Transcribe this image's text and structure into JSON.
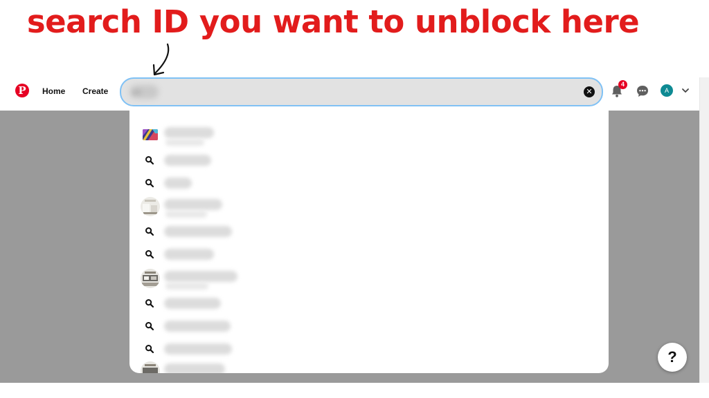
{
  "caption": {
    "text": "search ID you want to unblock here",
    "color": "#e21c1c"
  },
  "colors": {
    "brand": "#e60023",
    "focus_ring": "#7fc1f5",
    "search_bg": "#e2e2e2",
    "backdrop": "#9a9a9a",
    "avatar_bg": "#0e8a93"
  },
  "header": {
    "logo_icon": "pinterest-logo",
    "logo_glyph": "P",
    "nav": [
      {
        "label": "Home"
      },
      {
        "label": "Create"
      }
    ],
    "search": {
      "value": "ab"
    },
    "notifications": {
      "icon": "bell-icon",
      "count": "4"
    },
    "messages": {
      "icon": "chat-bubble-icon"
    },
    "avatar": {
      "initial": "A"
    },
    "account_menu_icon": "chevron-down-icon"
  },
  "dropdown": {
    "results": [
      {
        "kind": "profile",
        "thumb": "colorful-art-thumbnail",
        "label": "blurred"
      },
      {
        "kind": "query",
        "icon": "search-icon",
        "label": "blurred"
      },
      {
        "kind": "query",
        "icon": "search-icon",
        "label": "blurred"
      },
      {
        "kind": "profile",
        "thumb": "room-decor-thumbnail",
        "label": "blurred"
      },
      {
        "kind": "query",
        "icon": "search-icon",
        "label": "blurred"
      },
      {
        "kind": "query",
        "icon": "search-icon",
        "label": "blurred"
      },
      {
        "kind": "profile",
        "thumb": "room-decor-thumbnail",
        "label": "blurred"
      },
      {
        "kind": "query",
        "icon": "search-icon",
        "label": "blurred"
      },
      {
        "kind": "query",
        "icon": "search-icon",
        "label": "blurred"
      },
      {
        "kind": "query",
        "icon": "search-icon",
        "label": "blurred"
      },
      {
        "kind": "profile",
        "thumb": "room-decor-thumbnail",
        "label": "blurred"
      }
    ]
  },
  "help": {
    "label": "?"
  }
}
